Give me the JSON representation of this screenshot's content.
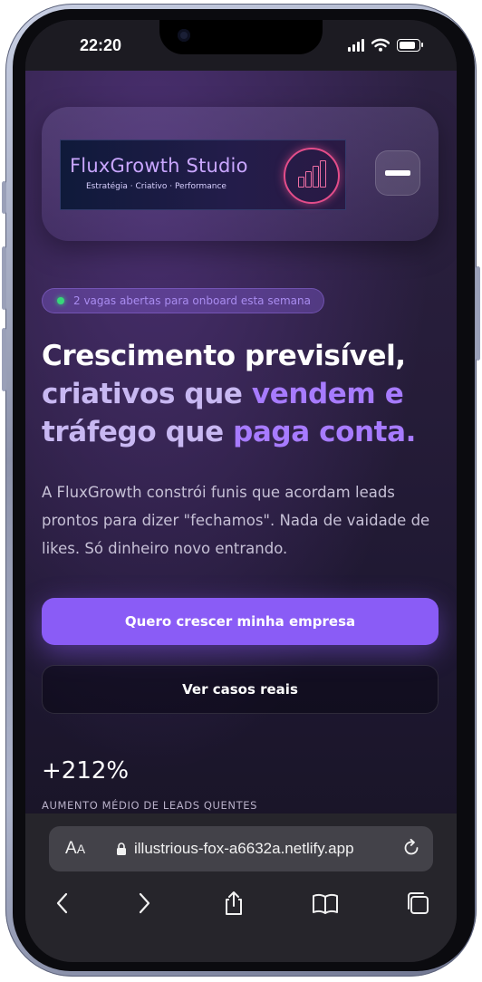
{
  "status_bar": {
    "time": "22:20"
  },
  "header": {
    "logo_title": "FluxGrowth Studio",
    "logo_subtitle": "Estratégia · Criativo · Performance",
    "menu_icon": "menu-icon"
  },
  "hero": {
    "badge": "2 vagas abertas para onboard esta semana",
    "headline": {
      "line1": "Crescimento previsível,",
      "line2_a": "criativos que ",
      "line2_b": "vendem e",
      "line3_a": "tráfego que ",
      "line3_b": "paga conta."
    },
    "lead": "A FluxGrowth constrói funis que acordam leads prontos para dizer \"fechamos\". Nada de vaidade de likes. Só dinheiro novo entrando.",
    "cta_primary": "Quero crescer minha empresa",
    "cta_secondary": "Ver casos reais"
  },
  "stat": {
    "value": "+212%",
    "label": "AUMENTO MÉDIO DE LEADS QUENTES"
  },
  "browser": {
    "aa_big": "A",
    "aa_small": "A",
    "url": "illustrious-fox-a6632a.netlify.app",
    "nav_icons": [
      "back-icon",
      "forward-icon",
      "share-icon",
      "bookmarks-icon",
      "tabs-icon"
    ]
  },
  "colors": {
    "accent": "#8a5cf6",
    "highlight": "#a77bff",
    "online_dot": "#37d67a"
  }
}
